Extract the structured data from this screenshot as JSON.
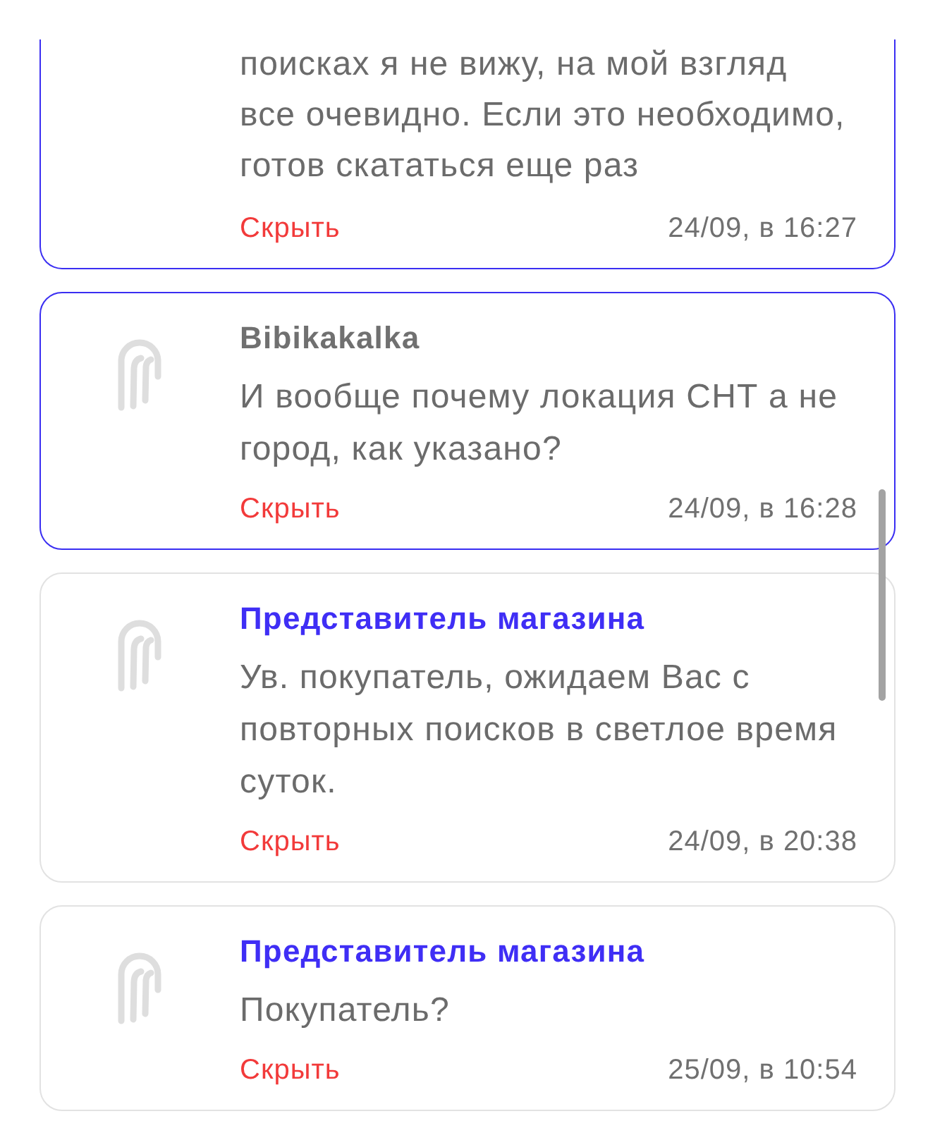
{
  "comments": [
    {
      "kind": "clipped",
      "highlighted": true,
      "text": "поисках я не вижу, на мой взгляд все очевидно. Если это необходимо, готов скататься еще раз",
      "hide": "Скрыть",
      "date": "24/09, в 16:27"
    },
    {
      "kind": "full",
      "highlighted": true,
      "author": {
        "name": "Bibikakalka",
        "kind": "buyer"
      },
      "text": "И вообще почему локация СНТ а не город, как указано?",
      "hide": "Скрыть",
      "date": "24/09, в 16:28"
    },
    {
      "kind": "full",
      "highlighted": false,
      "author": {
        "name": "Представитель магазина",
        "kind": "shop"
      },
      "text": "Ув. покупатель, ожидаем Вас с повторных поисков в светлое время суток.",
      "hide": "Скрыть",
      "date": "24/09, в 20:38"
    },
    {
      "kind": "full",
      "highlighted": false,
      "author": {
        "name": "Представитель магазина",
        "kind": "shop"
      },
      "text": "Покупатель?",
      "hide": "Скрыть",
      "date": "25/09, в 10:54"
    }
  ]
}
